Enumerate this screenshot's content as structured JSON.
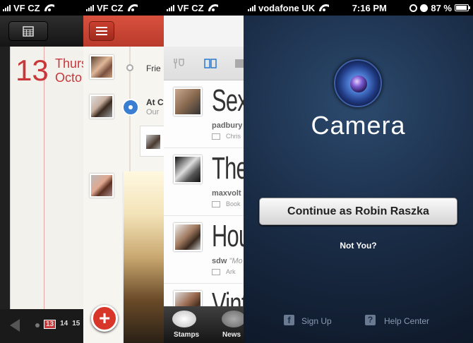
{
  "calendar_panel": {
    "status_carrier": "VF CZ",
    "day_number": "13",
    "weekday": "Thurs",
    "month": "Octo",
    "dates": [
      "13",
      "14",
      "15"
    ],
    "selected_date": "13"
  },
  "path_panel": {
    "status_carrier": "VF CZ",
    "item1_text": "Frie",
    "item2_text": "At C",
    "item2_sub": "Our",
    "add_label": "+"
  },
  "stamps_panel": {
    "status_carrier": "VF CZ",
    "rows": [
      {
        "big": "Sex",
        "user": "padbury",
        "sub": "Chris"
      },
      {
        "big": "The",
        "user": "maxvolt",
        "sub": "Book"
      },
      {
        "big": "Hou",
        "user": "sdw",
        "sub_extra": "\"Mo",
        "sub": "Ark"
      },
      {
        "big": "Vint",
        "user": "",
        "sub": ""
      }
    ],
    "tabs": [
      {
        "label": "Stamps",
        "icon": "stamps-icon"
      },
      {
        "label": "News",
        "icon": "news-icon"
      }
    ]
  },
  "camera_panel": {
    "status_carrier": "vodafone UK",
    "status_time": "7:16 PM",
    "battery": "87 %",
    "app_title": "Camera",
    "continue_label": "Continue as Robin Raszka",
    "not_you_label": "Not You?",
    "signup_label": "Sign Up",
    "help_label": "Help Center",
    "facebook_icon_glyph": "f",
    "help_icon_glyph": "?"
  }
}
